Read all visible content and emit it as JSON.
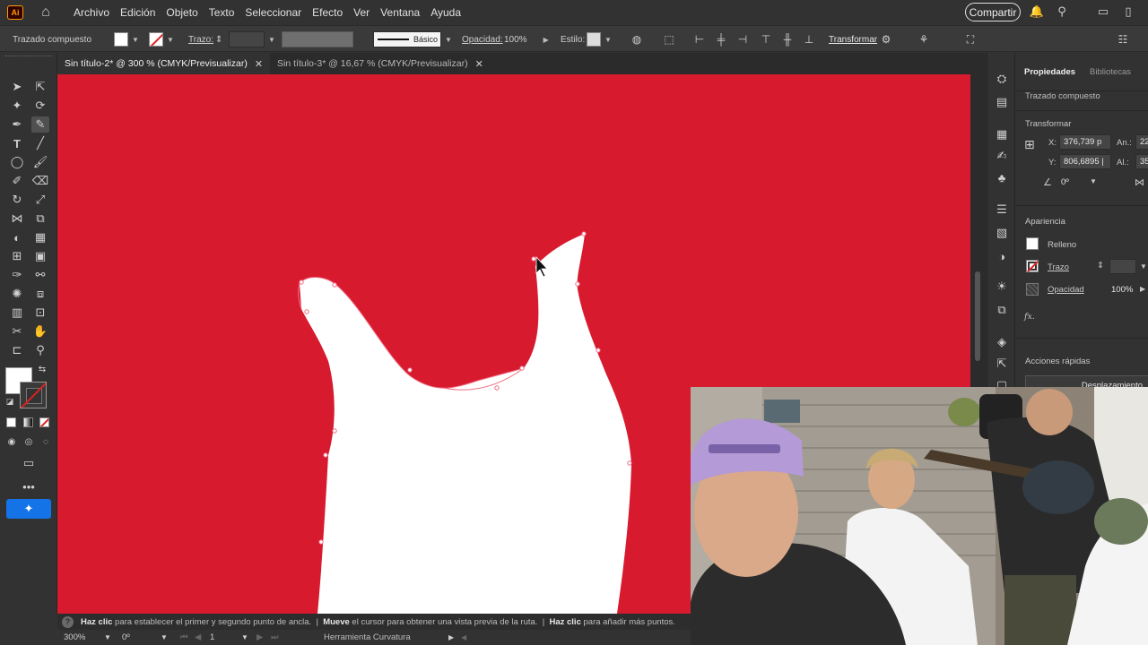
{
  "app": {
    "logo_text": "Ai",
    "menu": [
      "Archivo",
      "Edición",
      "Objeto",
      "Texto",
      "Seleccionar",
      "Efecto",
      "Ver",
      "Ventana",
      "Ayuda"
    ],
    "share_label": "Compartir"
  },
  "controlbar": {
    "selection_type": "Trazado compuesto",
    "stroke_label": "Trazo:",
    "brush_label": "Básico",
    "opacity_label": "Opacidad:",
    "opacity_value": "100%",
    "style_label": "Estilo:",
    "transform_label": "Transformar"
  },
  "tabs": [
    {
      "label": "Sin título-2* @ 300 % (CMYK/Previsualizar)",
      "active": true
    },
    {
      "label": "Sin título-3* @ 16,67 % (CMYK/Previsualizar)",
      "active": false
    }
  ],
  "properties": {
    "tabs": [
      "Propiedades",
      "Bibliotecas"
    ],
    "object_type": "Trazado compuesto",
    "transform_title": "Transformar",
    "x_label": "X:",
    "x_value": "376,739 p",
    "y_label": "Y:",
    "y_value": "806,6895 |",
    "w_label": "An.:",
    "w_value": "22",
    "h_label": "Al.:",
    "h_value": "35",
    "angle_value": "0º",
    "appearance_title": "Apariencia",
    "fill_label": "Relleno",
    "stroke_label": "Trazo",
    "opacity_label": "Opacidad",
    "opacity_value": "100%",
    "fx_label": "fx.",
    "quick_actions_title": "Acciones rápidas",
    "quick_action_button": "Desplazamiento"
  },
  "hint": {
    "b1": "Haz clic",
    "t1": " para establecer el primer y segundo punto de ancla.  |  ",
    "b2": "Mueve",
    "t2": " el cursor para obtener una vista previa de la ruta.  |  ",
    "b3": "Haz clic",
    "t3": " para añadir más puntos."
  },
  "status": {
    "zoom": "300%",
    "rotation": "0º",
    "artboard": "1",
    "tool_name": "Herramienta Curvatura"
  },
  "colors": {
    "canvas_bg": "#d71a2e",
    "shape_fill": "#ffffff",
    "accent_blue": "#1473e6"
  }
}
